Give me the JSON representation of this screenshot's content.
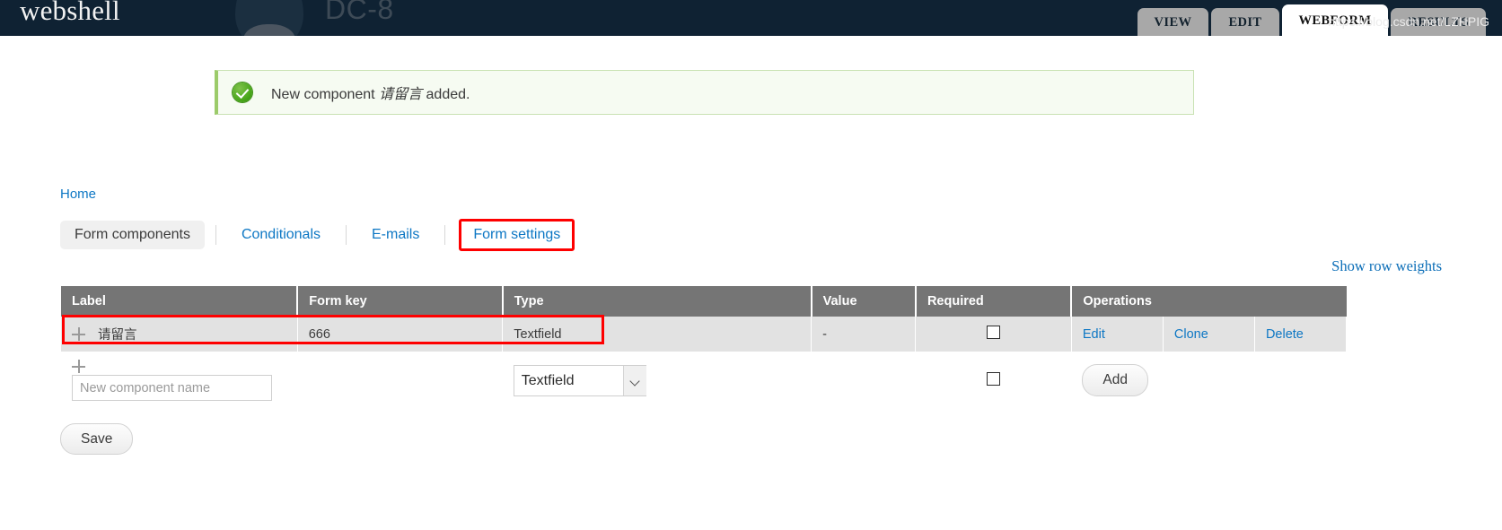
{
  "header": {
    "site_name": "webshell",
    "site_title": "DC-8",
    "logo_icon": "drupal-droplet-icon",
    "tabs": [
      {
        "label": "VIEW",
        "active": false
      },
      {
        "label": "EDIT",
        "active": false
      },
      {
        "label": "WEBFORM",
        "active": true
      },
      {
        "label": "RESULTS",
        "active": false
      }
    ]
  },
  "status": {
    "icon": "success-check-icon",
    "text_before": "New component ",
    "component_name": "请留言",
    "text_after": " added."
  },
  "breadcrumb": {
    "home_label": "Home"
  },
  "subtabs": [
    {
      "label": "Form components",
      "active": true,
      "highlighted": false
    },
    {
      "label": "Conditionals",
      "active": false,
      "highlighted": false
    },
    {
      "label": "E-mails",
      "active": false,
      "highlighted": false
    },
    {
      "label": "Form settings",
      "active": false,
      "highlighted": true
    }
  ],
  "links": {
    "show_row_weights": "Show row weights"
  },
  "table": {
    "columns": [
      "Label",
      "Form key",
      "Type",
      "Value",
      "Required",
      "Operations"
    ],
    "rows": [
      {
        "drag_icon": "drag-handle-icon",
        "label": "请留言",
        "form_key": "666",
        "type": "Textfield",
        "value": "-",
        "required": false,
        "operations": [
          "Edit",
          "Clone",
          "Delete"
        ]
      }
    ],
    "new_row": {
      "drag_icon": "drag-handle-icon",
      "name_placeholder": "New component name",
      "name_value": "",
      "type_selected": "Textfield",
      "type_options": [
        "Textfield"
      ],
      "required": false,
      "add_label": "Add"
    }
  },
  "actions": {
    "save_label": "Save"
  },
  "watermark": "https://blog.csdn.net/LZHPIG",
  "colors": {
    "header_bg": "#0f2233",
    "link": "#0d77c4",
    "table_header_bg": "#757575",
    "row_bg": "#e2e2e2",
    "highlight": "#fe0000",
    "status_bg": "#f6fbf2",
    "status_border": "#c9e2b3"
  }
}
